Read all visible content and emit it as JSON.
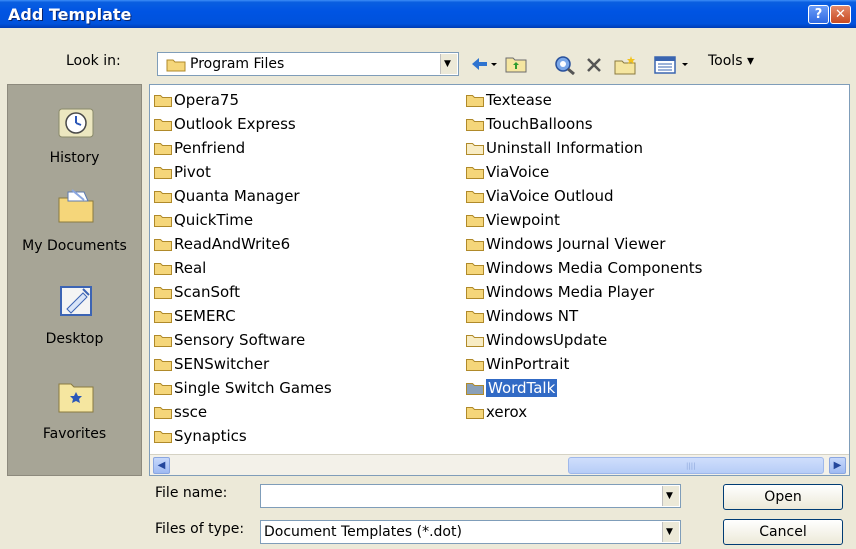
{
  "window": {
    "title": "Add Template",
    "help_glyph": "?",
    "close_glyph": "✕"
  },
  "lookin": {
    "label": "Look in:",
    "value": "Program Files"
  },
  "toolbar": {
    "tools_label": "Tools"
  },
  "places": [
    {
      "label": "History",
      "icon": "history-icon"
    },
    {
      "label": "My Documents",
      "icon": "my-documents-icon"
    },
    {
      "label": "Desktop",
      "icon": "desktop-icon"
    },
    {
      "label": "Favorites",
      "icon": "favorites-icon"
    }
  ],
  "files": {
    "col1": [
      "Opera75",
      "Outlook Express",
      "Penfriend",
      "Pivot",
      "Quanta Manager",
      "QuickTime",
      "ReadAndWrite6",
      "Real",
      "ScanSoft",
      "SEMERC",
      "Sensory Software",
      "SENSwitcher",
      "Single Switch Games",
      "ssce",
      "Synaptics"
    ],
    "col2": [
      "Textease",
      "TouchBalloons",
      "Uninstall Information",
      "ViaVoice",
      "ViaVoice Outloud",
      "Viewpoint",
      "Windows Journal Viewer",
      "Windows Media Components",
      "Windows Media Player",
      "Windows NT",
      "WindowsUpdate",
      "WinPortrait",
      "WordTalk",
      "xerox"
    ],
    "selected": "WordTalk"
  },
  "filename": {
    "label": "File name:",
    "value": ""
  },
  "filetype": {
    "label": "Files of type:",
    "value": "Document Templates (*.dot)"
  },
  "buttons": {
    "open": "Open",
    "cancel": "Cancel"
  },
  "colors": {
    "title_bar": "#0054e3",
    "selection": "#316ac5",
    "folder": "#f5d67a"
  }
}
